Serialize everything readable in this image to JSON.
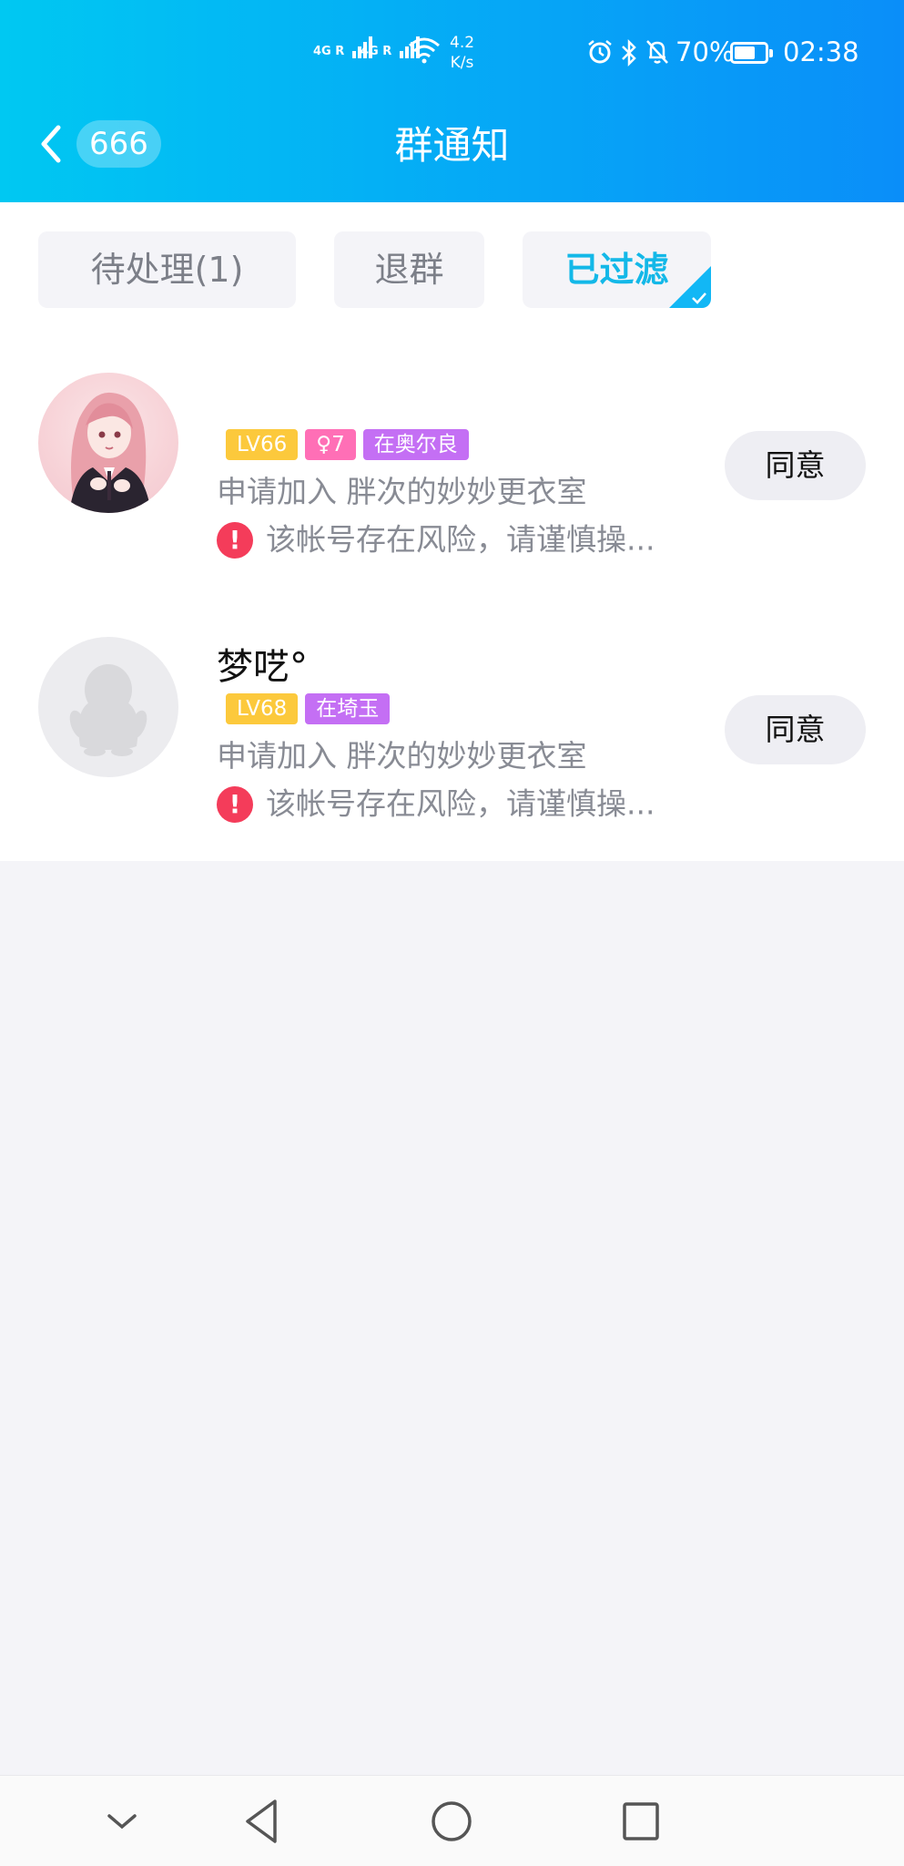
{
  "status_bar": {
    "signal1_label": "4G R",
    "signal2_label": "4G R",
    "net_speed_value": "4.2",
    "net_speed_unit": "K/s",
    "battery_percent": "70%",
    "battery_level": 0.7,
    "time": "02:38",
    "icons": [
      "alarm-icon",
      "bluetooth-icon",
      "mute-bell-icon",
      "wifi-icon",
      "battery-icon"
    ]
  },
  "header": {
    "back_count": "666",
    "title": "群通知",
    "color_left": "#00c8f2",
    "color_right": "#0a8ef9"
  },
  "tabs": [
    {
      "label": "待处理(1)",
      "active": false
    },
    {
      "label": "退群",
      "active": false
    },
    {
      "label": "已过滤",
      "active": true
    }
  ],
  "requests": [
    {
      "name": "",
      "tags": [
        {
          "text": "LV66",
          "kind": "level"
        },
        {
          "text": "7",
          "kind": "gender-age",
          "icon": "female-icon"
        },
        {
          "text": "在奥尔良",
          "kind": "location"
        }
      ],
      "apply_text": "申请加入 胖次的妙妙更衣室",
      "warning": "该帐号存在风险，请谨慎操...",
      "action_label": "同意"
    },
    {
      "name": "梦呓°",
      "tags": [
        {
          "text": "LV68",
          "kind": "level"
        },
        {
          "text": "在埼玉",
          "kind": "location"
        }
      ],
      "apply_text": "申请加入 胖次的妙妙更衣室",
      "warning": "该帐号存在风险，请谨慎操...",
      "action_label": "同意"
    }
  ],
  "nav_bar": {
    "icons": [
      "hide-chevron-icon",
      "back-triangle-icon",
      "home-circle-icon",
      "recents-square-icon"
    ]
  }
}
